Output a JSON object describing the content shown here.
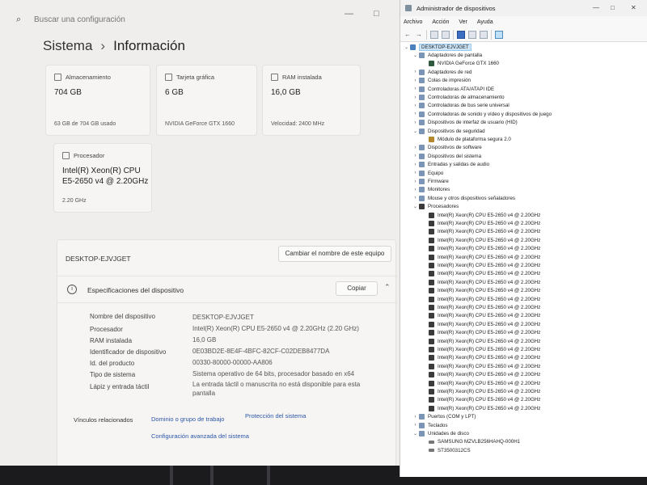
{
  "settings": {
    "search_placeholder": "Buscar una configuración",
    "breadcrumb": {
      "parent": "Sistema",
      "separator": "›",
      "current": "Información"
    },
    "cards": [
      {
        "title": "Almacenamiento",
        "value": "704 GB",
        "sub": "63 GB de 704 GB usado"
      },
      {
        "title": "Tarjeta gráfica",
        "value": "6 GB",
        "sub": "NVIDIA GeForce GTX 1660"
      },
      {
        "title": "RAM instalada",
        "value": "16,0 GB",
        "sub": "Velocidad: 2400 MHz"
      },
      {
        "title": "Procesador",
        "value": "Intel(R) Xeon(R) CPU E5-2650 v4 @ 2.20GHz",
        "sub": "2.20 GHz"
      }
    ],
    "device_name": "DESKTOP-EJVJGET",
    "rename_button": "Cambiar el nombre de este equipo",
    "specs_title": "Especificaciones del dispositivo",
    "copy_button": "Copiar",
    "specs": [
      {
        "key": "Nombre del dispositivo",
        "value": "DESKTOP-EJVJGET"
      },
      {
        "key": "Procesador",
        "value": "Intel(R) Xeon(R) CPU E5-2650 v4 @ 2.20GHz (2.20 GHz)"
      },
      {
        "key": "RAM instalada",
        "value": "16,0 GB"
      },
      {
        "key": "Identificador de dispositivo",
        "value": "0E03BD2E-8E4F-4BFC-82CF-C02DEB8477DA"
      },
      {
        "key": "Id. del producto",
        "value": "00330-80000-00000-AA806"
      },
      {
        "key": "Tipo de sistema",
        "value": "Sistema operativo de 64 bits, procesador basado en x64"
      },
      {
        "key": "Lápiz y entrada táctil",
        "value": "La entrada táctil o manuscrita no está disponible para esta pantalla"
      }
    ],
    "related_label": "Vínculos relacionados",
    "related_links": [
      "Dominio o grupo de trabajo",
      "Protección del sistema",
      "Configuración avanzada del sistema"
    ]
  },
  "devmgr": {
    "title": "Administrador de dispositivos",
    "menu": [
      "Archivo",
      "Acción",
      "Ver",
      "Ayuda"
    ],
    "root": "DESKTOP-EJVJGET",
    "cpu_entry": "Intel(R) Xeon(R) CPU E5-2650 v4 @ 2.20GHz",
    "cpu_count": 24,
    "tree_before_cpu": [
      {
        "level": 1,
        "expander": "v",
        "icon": "cat",
        "label": "Adaptadores de pantalla"
      },
      {
        "level": 2,
        "expander": "",
        "icon": "gpu",
        "label": "NVIDIA GeForce GTX 1660"
      },
      {
        "level": 1,
        "expander": ">",
        "icon": "cat",
        "label": "Adaptadores de red"
      },
      {
        "level": 1,
        "expander": ">",
        "icon": "cat",
        "label": "Colas de impresión"
      },
      {
        "level": 1,
        "expander": ">",
        "icon": "cat",
        "label": "Controladoras ATA/ATAPI IDE"
      },
      {
        "level": 1,
        "expander": ">",
        "icon": "cat",
        "label": "Controladoras de almacenamiento"
      },
      {
        "level": 1,
        "expander": ">",
        "icon": "cat",
        "label": "Controladoras de bus serie universal"
      },
      {
        "level": 1,
        "expander": ">",
        "icon": "cat",
        "label": "Controladoras de sonido y vídeo y dispositivos de juego"
      },
      {
        "level": 1,
        "expander": ">",
        "icon": "cat",
        "label": "Dispositivos de interfaz de usuario (HID)"
      },
      {
        "level": 1,
        "expander": "v",
        "icon": "cat",
        "label": "Dispositivos de seguridad"
      },
      {
        "level": 2,
        "expander": "",
        "icon": "sec",
        "label": "Módulo de plataforma segura 2.0"
      },
      {
        "level": 1,
        "expander": ">",
        "icon": "cat",
        "label": "Dispositivos de software"
      },
      {
        "level": 1,
        "expander": ">",
        "icon": "cat",
        "label": "Dispositivos del sistema"
      },
      {
        "level": 1,
        "expander": ">",
        "icon": "cat",
        "label": "Entradas y salidas de audio"
      },
      {
        "level": 1,
        "expander": ">",
        "icon": "cat",
        "label": "Equipo"
      },
      {
        "level": 1,
        "expander": ">",
        "icon": "cat",
        "label": "Firmware"
      },
      {
        "level": 1,
        "expander": ">",
        "icon": "cat",
        "label": "Monitores"
      },
      {
        "level": 1,
        "expander": ">",
        "icon": "cat",
        "label": "Mouse y otros dispositivos señaladores"
      },
      {
        "level": 1,
        "expander": "v",
        "icon": "cpu",
        "label": "Procesadores"
      }
    ],
    "tree_after_cpu": [
      {
        "level": 1,
        "expander": ">",
        "icon": "cat",
        "label": "Puertos (COM y LPT)"
      },
      {
        "level": 1,
        "expander": ">",
        "icon": "cat",
        "label": "Teclados"
      },
      {
        "level": 1,
        "expander": "v",
        "icon": "cat",
        "label": "Unidades de disco"
      },
      {
        "level": 2,
        "expander": "",
        "icon": "disk",
        "label": "SAMSUNG MZVLB256HAHQ-000H1"
      },
      {
        "level": 2,
        "expander": "",
        "icon": "disk",
        "label": "ST3500312CS"
      }
    ]
  }
}
